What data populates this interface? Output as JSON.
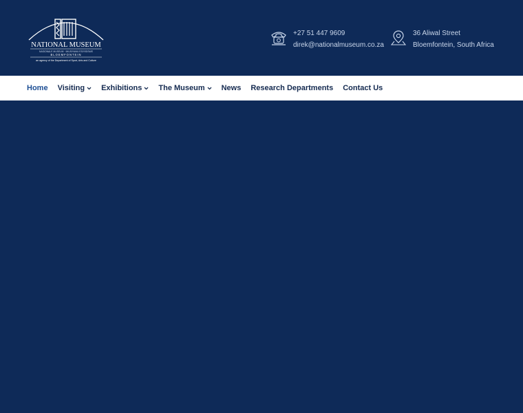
{
  "brand": {
    "name": "NATIONAL MUSEUM",
    "subname_lines": "NASIONALE MUSEUM · IMUSIYAMU ESIYISISWE",
    "city": "BLOEMFONTEIN",
    "agency_line": "an agency of the Department of Sport, Arts and Culture"
  },
  "contact": {
    "phone": "+27 51 447 9609",
    "email": "direk@nationalmuseum.co.za",
    "address_line1": "36 Aliwal Street",
    "address_line2": "Bloemfontein, South Africa",
    "phone_icon": "telephone-icon",
    "location_icon": "map-pin-icon"
  },
  "nav": {
    "items": [
      {
        "label": "Home",
        "dropdown": false,
        "active": true
      },
      {
        "label": "Visiting",
        "dropdown": true,
        "active": false
      },
      {
        "label": "Exhibitions",
        "dropdown": true,
        "active": false
      },
      {
        "label": "The Museum",
        "dropdown": true,
        "active": false
      },
      {
        "label": "News",
        "dropdown": false,
        "active": false
      },
      {
        "label": "Research Departments",
        "dropdown": false,
        "active": false
      },
      {
        "label": "Contact Us",
        "dropdown": false,
        "active": false
      }
    ],
    "search_icon": "search-icon"
  },
  "colors": {
    "primary_navy": "#0e2a58",
    "nav_background": "#ffffff",
    "nav_text": "#142a50",
    "active_link": "#1d4e94"
  }
}
